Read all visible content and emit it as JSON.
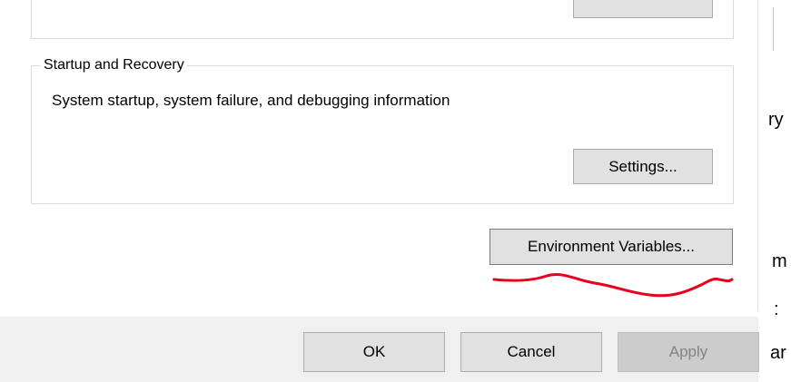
{
  "dialog": {
    "top_group": {
      "button_label": ""
    },
    "startup_group": {
      "title": "Startup and Recovery",
      "description": "System startup, system failure, and debugging information",
      "settings_label": "Settings..."
    },
    "env_vars_label": "Environment Variables...",
    "footer": {
      "ok_label": "OK",
      "cancel_label": "Cancel",
      "apply_label": "Apply"
    }
  },
  "background_window": {
    "fragments": [
      "ry",
      "m",
      ":",
      "ar"
    ]
  },
  "colors": {
    "button_face": "#e1e1e1",
    "button_border": "#adadad",
    "disabled_text": "#838383",
    "annotation": "#e8001c",
    "footer_band": "#f0f0f0"
  }
}
